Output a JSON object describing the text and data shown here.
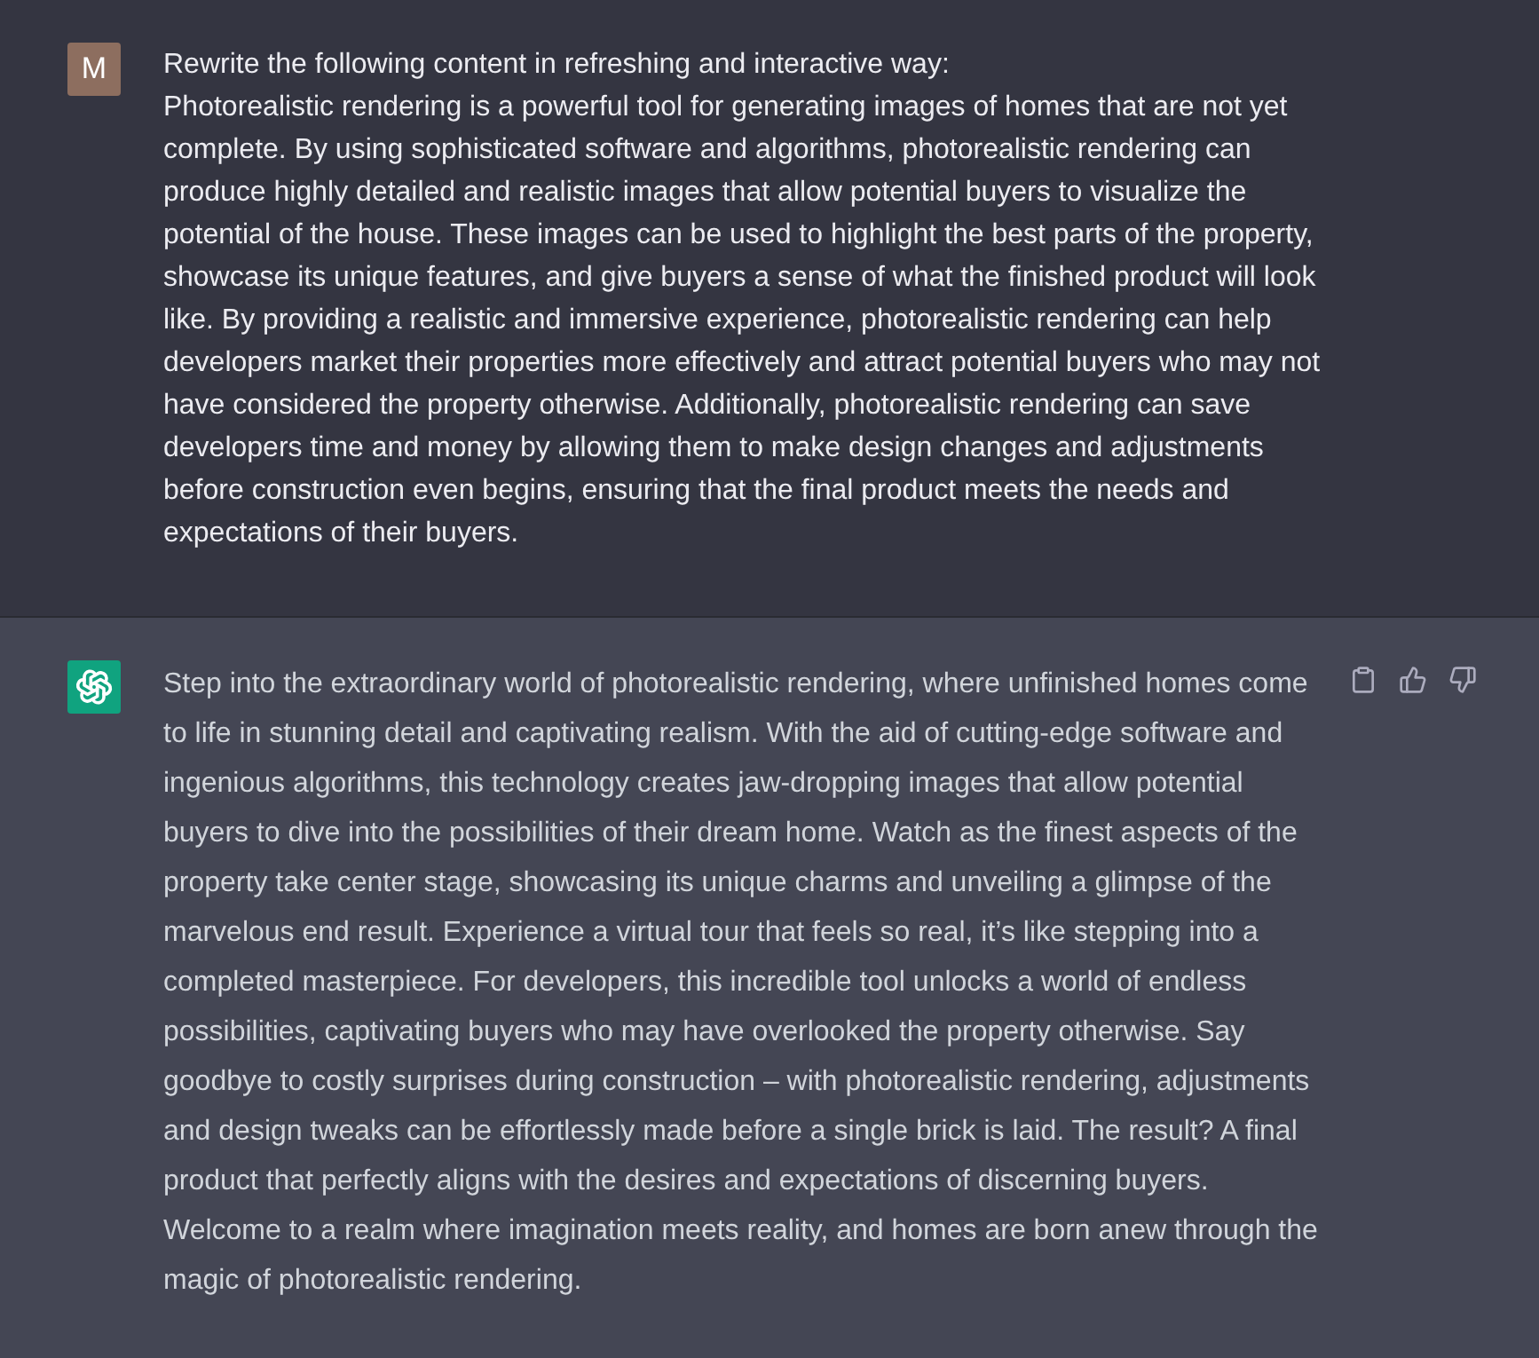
{
  "conversation": {
    "messages": [
      {
        "kind": "user",
        "avatar_letter": "M",
        "text": "Rewrite the following content in refreshing and interactive way:\nPhotorealistic rendering is a powerful tool for generating images of homes that are not yet complete. By using sophisticated software and algorithms, photorealistic rendering can produce highly detailed and realistic images that allow potential buyers to visualize the potential of the house. These images can be used to highlight the best parts of the property, showcase its unique features, and give buyers a sense of what the finished product will look like. By providing a realistic and immersive experience, photorealistic rendering can help developers market their properties more effectively and attract potential buyers who may not have considered the property otherwise. Additionally, photorealistic rendering can save developers time and money by allowing them to make design changes and adjustments before construction even begins, ensuring that the final product meets the needs and expectations of their buyers."
      },
      {
        "kind": "assistant",
        "text": "Step into the extraordinary world of photorealistic rendering, where unfinished homes come to life in stunning detail and captivating realism. With the aid of cutting-edge software and ingenious algorithms, this technology creates jaw-dropping images that allow potential buyers to dive into the possibilities of their dream home. Watch as the finest aspects of the property take center stage, showcasing its unique charms and unveiling a glimpse of the marvelous end result. Experience a virtual tour that feels so real, it’s like stepping into a completed masterpiece. For developers, this incredible tool unlocks a world of endless possibilities, captivating buyers who may have overlooked the property otherwise. Say goodbye to costly surprises during construction – with photorealistic rendering, adjustments and design tweaks can be effortlessly made before a single brick is laid. The result? A final product that perfectly aligns with the desires and expectations of discerning buyers. Welcome to a realm where imagination meets reality, and homes are born anew through the magic of photorealistic rendering."
      }
    ]
  }
}
